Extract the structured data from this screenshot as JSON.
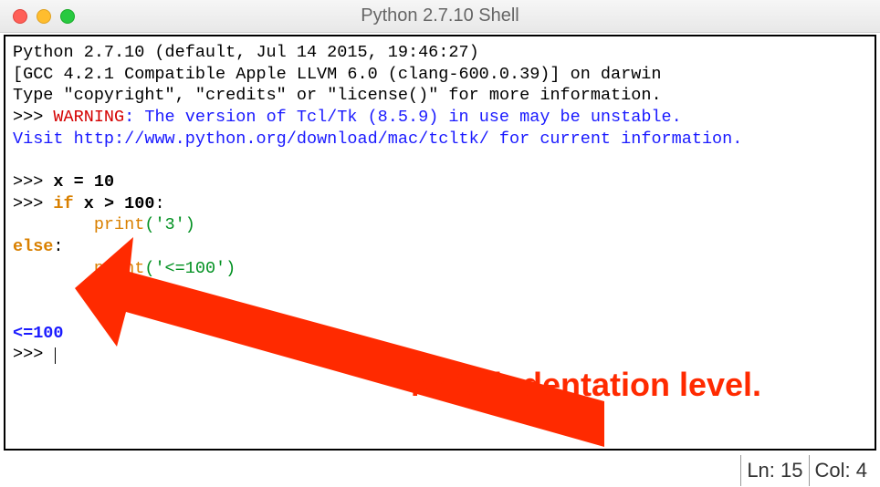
{
  "window": {
    "title": "Python 2.7.10 Shell"
  },
  "banner": {
    "line1": "Python 2.7.10 (default, Jul 14 2015, 19:46:27)",
    "line2": "[GCC 4.2.1 Compatible Apple LLVM 6.0 (clang-600.0.39)] on darwin",
    "line3_prefix": "Type ",
    "line3_q1": "\"copyright\"",
    "line3_c1": ", ",
    "line3_q2": "\"credits\"",
    "line3_c2": " or ",
    "line3_q3": "\"license()\"",
    "line3_suffix": " for more information.",
    "warn_prompt": ">>> ",
    "warn_label": "WARNING",
    "warn_text": ": The version of Tcl/Tk (8.5.9) in use may be unstable.",
    "visit_prefix": "Visit ",
    "visit_url": "http://www.python.org/download/mac/tcltk/",
    "visit_suffix": " for current information."
  },
  "code": {
    "prompt": ">>> ",
    "l1_a": "x ",
    "l1_op": "=",
    "l1_b": " 10",
    "l2_if": "if",
    "l2_mid": " x > ",
    "l2_num": "100",
    "l2_colon": ":",
    "indent8": "        ",
    "print": "print",
    "l3_args": "('3')",
    "else": "else",
    "l5_args": "('<=100')",
    "output": "<=100",
    "final_prompt": ">>> "
  },
  "annotation": {
    "text": "Note indentation level."
  },
  "status": {
    "ln_label": "Ln: ",
    "ln_val": "15",
    "col_label": "Col: ",
    "col_val": "4"
  }
}
